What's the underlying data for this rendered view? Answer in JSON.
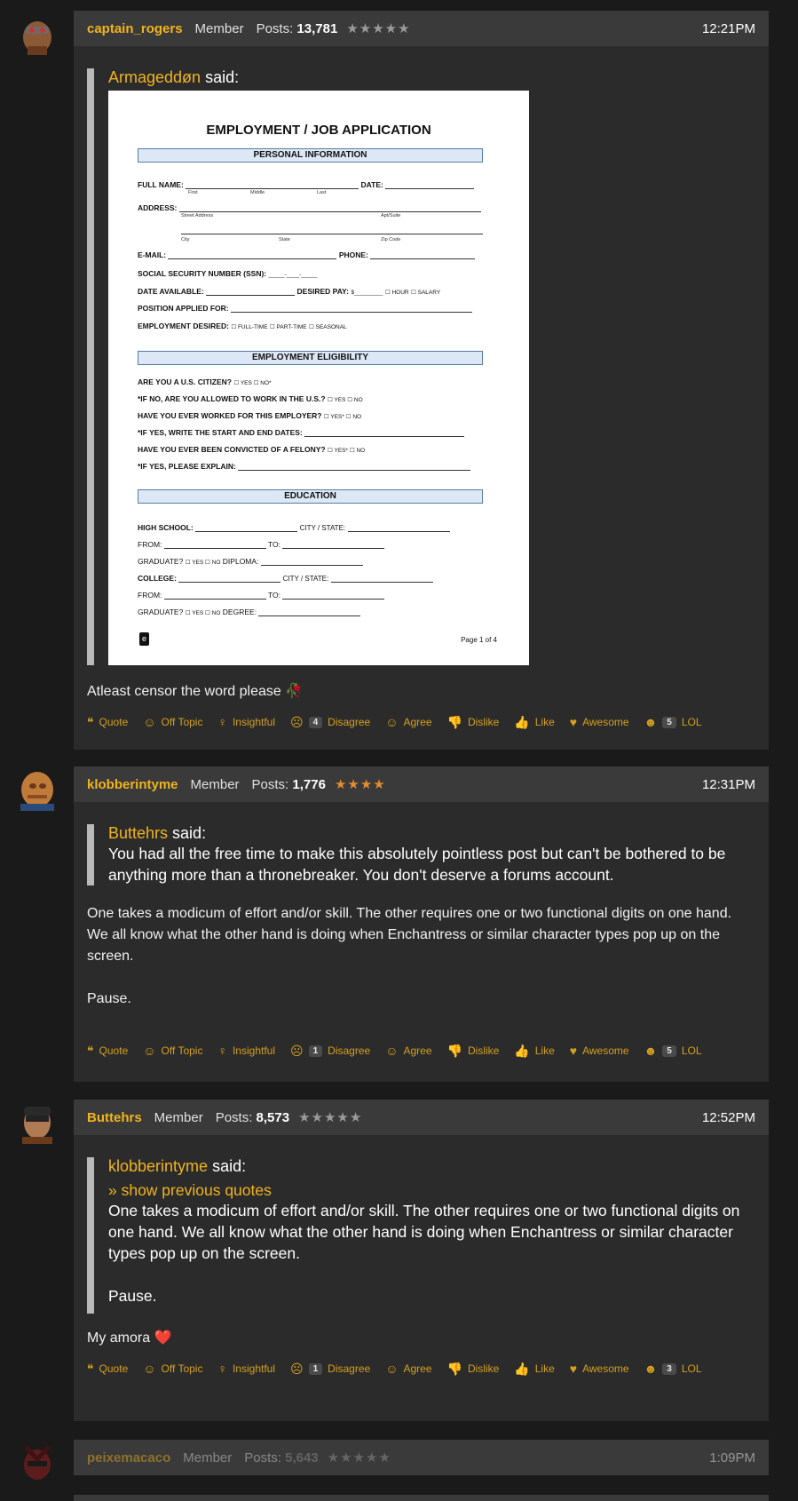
{
  "actions": [
    "Quote",
    "Off Topic",
    "Insightful",
    "Disagree",
    "Agree",
    "Dislike",
    "Like",
    "Awesome",
    "LOL"
  ],
  "posts": [
    {
      "user": "captain_rogers",
      "role": "Member",
      "posts_label": "Posts:",
      "posts_count": "13,781",
      "stars": "★★★★★",
      "time": "12:21PM",
      "quote_author": "Armageddøn",
      "said": " said:",
      "text": "Atleast censor the word please 🥀",
      "disagree_count": "4",
      "lol_count": "5"
    },
    {
      "user": "klobberintyme",
      "role": "Member",
      "posts_label": "Posts:",
      "posts_count": "1,776",
      "stars": "★★★★",
      "time": "12:31PM",
      "quote_author": "Buttehrs",
      "said": " said:",
      "quote_text": "You had all the free time to make this absolutely pointless post but can't be bothered to be anything more than a thronebreaker. You don't deserve a forums account.",
      "text_1": "One takes a modicum of effort and/or skill. The other requires one or two functional digits on one hand. We all know what the other hand is doing when Enchantress or similar character types pop up on the screen.",
      "text_2": "Pause.",
      "disagree_count": "1",
      "lol_count": "5"
    },
    {
      "user": "Buttehrs",
      "role": "Member",
      "posts_label": "Posts:",
      "posts_count": "8,573",
      "stars": "★★★★★",
      "time": "12:52PM",
      "quote_author": "klobberintyme",
      "said": " said:",
      "show_previous": "» show previous quotes",
      "quote_text_1": "One takes a modicum of effort and/or skill. The other requires one or two functional digits on one hand. We all know what the other hand is doing when Enchantress or similar character types pop up on the screen.",
      "quote_text_2": "Pause.",
      "text": "My amora ❤️",
      "disagree_count": "1",
      "lol_count": "3"
    },
    {
      "user": "peixemacaco",
      "role": "Member",
      "posts_label": "Posts:",
      "posts_count": "5,643",
      "stars": "★★★★★",
      "time": "1:09PM"
    }
  ],
  "document": {
    "title": "EMPLOYMENT / JOB APPLICATION",
    "sec_personal": "PERSONAL INFORMATION",
    "full_name": "FULL NAME:",
    "date": "DATE:",
    "first": "First",
    "middle": "Middle",
    "last": "Last",
    "address": "ADDRESS:",
    "street": "Street Address",
    "apt": "Apt/Suite",
    "city": "City",
    "state": "State",
    "zip": "Zip Code",
    "email": "E-MAIL:",
    "phone": "PHONE:",
    "ssn": "SOCIAL SECURITY NUMBER (SSN):",
    "ssn_blank": "_____-____-_____",
    "date_available": "DATE AVAILABLE:",
    "desired_pay": "DESIRED PAY:",
    "pay_blank": "$_________",
    "hour": "☐ HOUR",
    "salary": "☐ SALARY",
    "position": "POSITION APPLIED FOR:",
    "employment_desired": "EMPLOYMENT DESIRED:",
    "ft": "☐ FULL-TIME",
    "pt": "☐ PART-TIME",
    "seasonal": "☐ SEASONAL",
    "sec_elig": "EMPLOYMENT ELIGIBILITY",
    "q1": "ARE YOU A U.S. CITIZEN?",
    "q1_opts": "☐ YES  ☐ NO*",
    "q2": "*IF NO, ARE YOU ALLOWED TO WORK IN THE U.S.?",
    "q2_opts": "☐ YES  ☐ NO",
    "q3": "HAVE YOU EVER WORKED FOR THIS EMPLOYER?",
    "q3_opts": "☐ YES*  ☐ NO",
    "q4": "*IF YES, WRITE THE START AND END DATES:",
    "q5": "HAVE YOU EVER BEEN CONVICTED OF A FELONY?",
    "q5_opts": "☐ YES*  ☐ NO",
    "q6": "*IF YES, PLEASE EXPLAIN:",
    "sec_edu": "EDUCATION",
    "hs": "HIGH SCHOOL:",
    "city_state": "CITY / STATE:",
    "from": "FROM:",
    "to": "TO:",
    "graduate": "GRADUATE?",
    "yes_no": "☐ YES  ☐ NO",
    "diploma": "DIPLOMA:",
    "college": "COLLEGE:",
    "degree": "DEGREE:",
    "page": "Page 1 of 4"
  },
  "colors": {
    "accent": "#f0b41e",
    "action": "#d4a01e",
    "card": "#2b2b2b",
    "header": "#3a3a3a",
    "bg": "#1a1a1a"
  }
}
